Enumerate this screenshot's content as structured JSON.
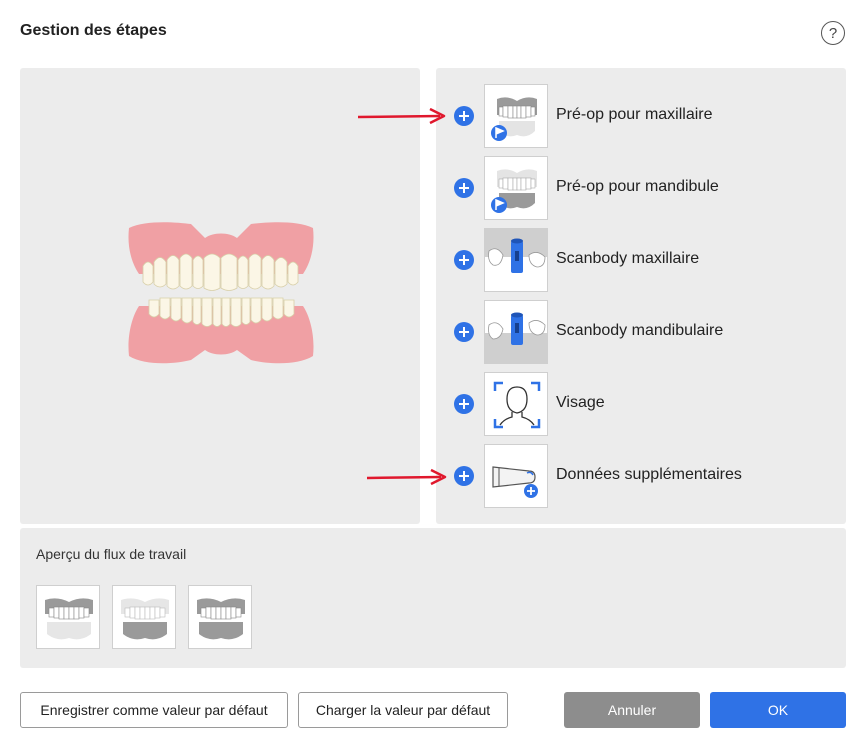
{
  "dialog": {
    "title": "Gestion des étapes",
    "help_label": "?"
  },
  "steps": [
    {
      "label": "Pré-op pour maxillaire",
      "icon": "preop-maxilla-icon"
    },
    {
      "label": "Pré-op pour mandibule",
      "icon": "preop-mandible-icon"
    },
    {
      "label": "Scanbody maxillaire",
      "icon": "scanbody-maxilla-icon"
    },
    {
      "label": "Scanbody mandibulaire",
      "icon": "scanbody-mandible-icon"
    },
    {
      "label": "Visage",
      "icon": "face-scan-icon"
    },
    {
      "label": "Données supplémentaires",
      "icon": "additional-data-icon"
    }
  ],
  "workflow": {
    "title": "Aperçu du flux de travail"
  },
  "buttons": {
    "save_default": "Enregistrer comme valeur par défaut",
    "load_default": "Charger la valeur par défaut",
    "cancel": "Annuler",
    "ok": "OK"
  },
  "colors": {
    "accent": "#2f72e6",
    "arrow": "#e0182d",
    "panel": "#ececec",
    "gum": "#f0a0a4",
    "cancel": "#8d8d8d"
  }
}
